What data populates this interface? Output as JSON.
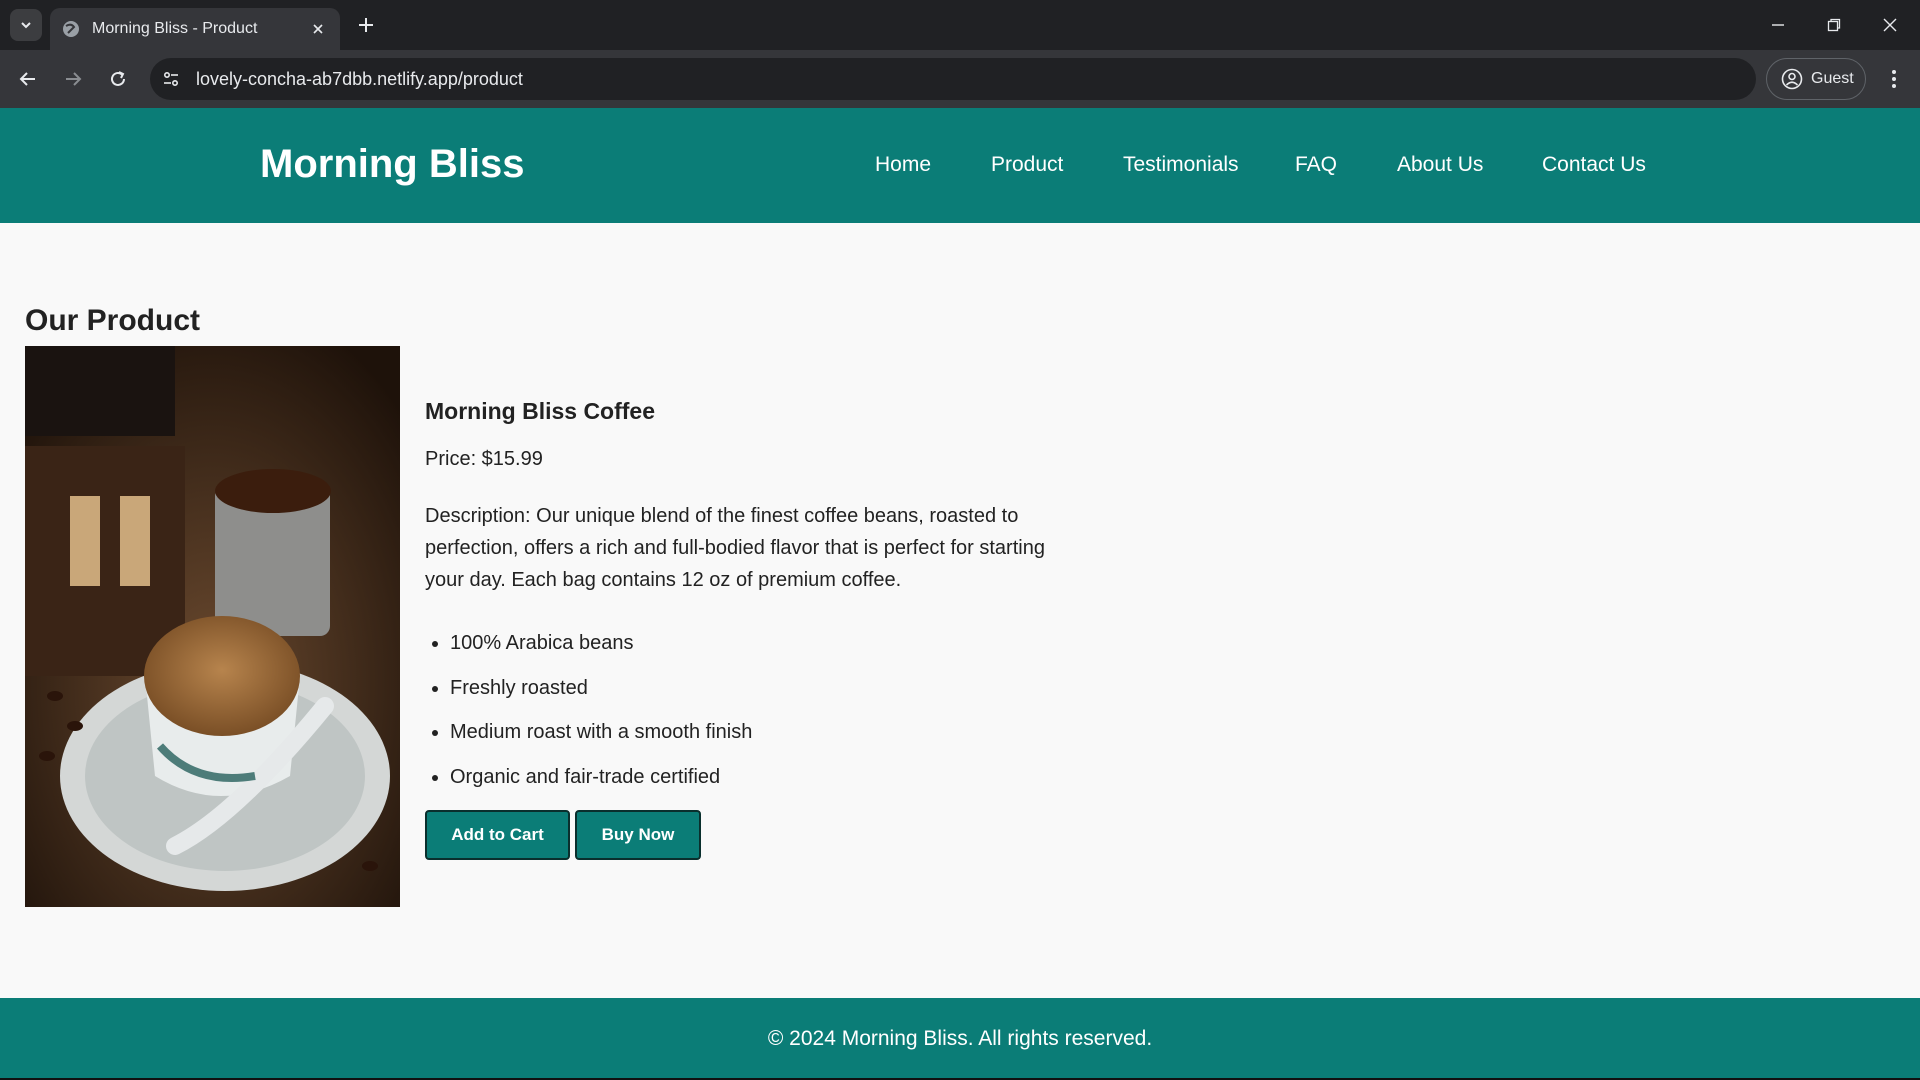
{
  "browser": {
    "tab_title": "Morning Bliss - Product",
    "url": "lovely-concha-ab7dbb.netlify.app/product",
    "profile_label": "Guest"
  },
  "site": {
    "logo": "Morning Bliss",
    "nav": [
      "Home",
      "Product",
      "Testimonials",
      "FAQ",
      "About Us",
      "Contact Us"
    ],
    "footer": "© 2024 Morning Bliss. All rights reserved."
  },
  "main": {
    "section_title": "Our Product",
    "product_name": "Morning Bliss Coffee",
    "price": "Price: $15.99",
    "description": "Description: Our unique blend of the finest coffee beans, roasted to perfection, offers a rich and full-bodied flavor that is perfect for starting your day. Each bag contains 12 oz of premium coffee.",
    "features": [
      "100% Arabica beans",
      "Freshly roasted",
      "Medium roast with a smooth finish",
      "Organic and fair-trade certified"
    ],
    "add_to_cart": "Add to Cart",
    "buy_now": "Buy Now"
  },
  "colors": {
    "brand_teal": "#0b7d77",
    "page_bg": "#f9f9f9",
    "chrome_dark": "#202124"
  }
}
